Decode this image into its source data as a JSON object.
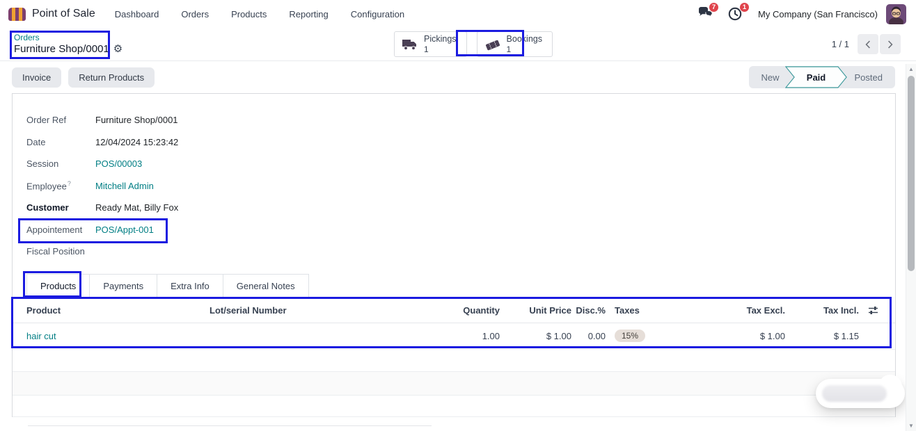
{
  "navbar": {
    "app_name": "Point of Sale",
    "menu": [
      "Dashboard",
      "Orders",
      "Products",
      "Reporting",
      "Configuration"
    ],
    "messages_badge": "7",
    "activities_badge": "1",
    "company": "My Company (San Francisco)"
  },
  "control_panel": {
    "breadcrumb": {
      "parent": "Orders",
      "current": "Furniture Shop/0001"
    },
    "stat_buttons": [
      {
        "label": "Pickings",
        "count": "1",
        "icon": "truck-icon"
      },
      {
        "label": "Bookings",
        "count": "1",
        "icon": "ticket-icon",
        "highlighted": true
      }
    ],
    "pager": {
      "text": "1 / 1"
    }
  },
  "actions": {
    "buttons": [
      "Invoice",
      "Return Products"
    ]
  },
  "statusbar": {
    "steps": [
      "New",
      "Paid",
      "Posted"
    ],
    "active_step": "Paid"
  },
  "form": {
    "fields": [
      {
        "label": "Order Ref",
        "value": "Furniture Shop/0001"
      },
      {
        "label": "Date",
        "value": "12/04/2024 15:23:42"
      },
      {
        "label": "Session",
        "value": "POS/00003"
      },
      {
        "label": "Employee",
        "help": "?",
        "value": "Mitchell Admin"
      },
      {
        "label": "Customer",
        "value": "Ready Mat, Billy Fox"
      },
      {
        "label": "Appointement",
        "value": "POS/Appt-001"
      },
      {
        "label": "Fiscal Position",
        "value": ""
      }
    ]
  },
  "tabs": [
    "Products",
    "Payments",
    "Extra Info",
    "General Notes"
  ],
  "products_table": {
    "columns": [
      "Product",
      "Lot/serial Number",
      "Quantity",
      "Unit Price",
      "Disc.%",
      "Taxes",
      "Tax Excl.",
      "Tax Incl."
    ],
    "rows": [
      {
        "product": "hair cut",
        "lot_serial": "",
        "quantity": "1.00",
        "unit_price": "$ 1.00",
        "discount": "0.00",
        "taxes": "15%",
        "tax_excl": "$ 1.00",
        "tax_incl": "$ 1.15"
      }
    ]
  },
  "colors": {
    "accent_teal": "#017e84",
    "annotation_blue": "#1b1be0",
    "badge_red": "#e0444c",
    "button_gray": "#e7e9ed",
    "statusbar_active_border": "#3e9a9c"
  }
}
